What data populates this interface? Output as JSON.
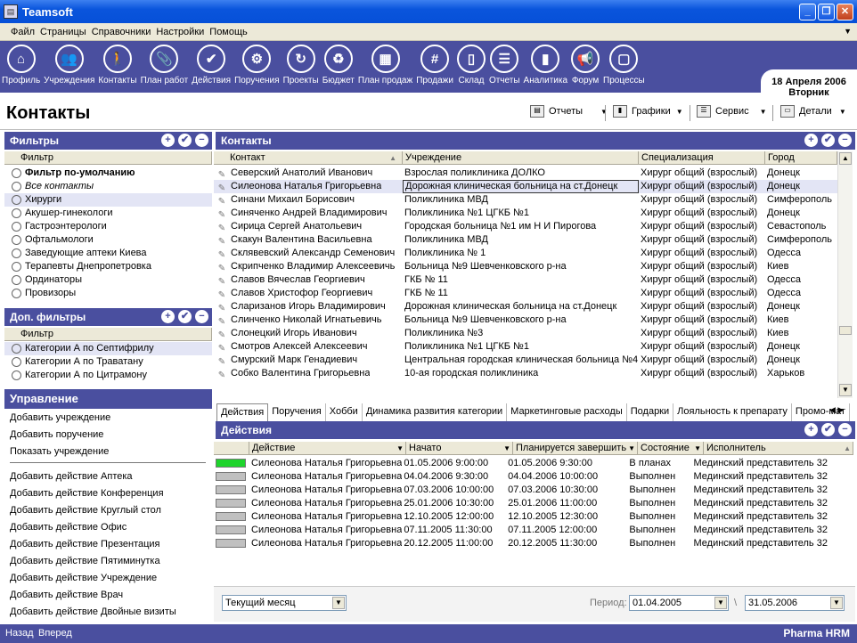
{
  "window": {
    "title": "Teamsoft"
  },
  "menu": [
    "Файл",
    "Страницы",
    "Справочники",
    "Настройки",
    "Помощь"
  ],
  "toolbar": [
    {
      "label": "Профиль",
      "icon": "home-icon",
      "glyph": "⌂"
    },
    {
      "label": "Учреждения",
      "icon": "people-icon",
      "glyph": "👥"
    },
    {
      "label": "Контакты",
      "icon": "person-icon",
      "glyph": "🚶"
    },
    {
      "label": "План работ",
      "icon": "paperclip-icon",
      "glyph": "📎"
    },
    {
      "label": "Действия",
      "icon": "checkmark-icon",
      "glyph": "✔"
    },
    {
      "label": "Поручения",
      "icon": "gears-icon",
      "glyph": "⚙"
    },
    {
      "label": "Проекты",
      "icon": "arrow-icon",
      "glyph": "↻"
    },
    {
      "label": "Бюджет",
      "icon": "recycle-icon",
      "glyph": "♻"
    },
    {
      "label": "План продаж",
      "icon": "grid-icon",
      "glyph": "▦"
    },
    {
      "label": "Продажи",
      "icon": "hash-icon",
      "glyph": "#"
    },
    {
      "label": "Склад",
      "icon": "phone-icon",
      "glyph": "▯"
    },
    {
      "label": "Отчеты",
      "icon": "document-icon",
      "glyph": "☰"
    },
    {
      "label": "Аналитика",
      "icon": "bar-chart-icon",
      "glyph": "▮"
    },
    {
      "label": "Форум",
      "icon": "megaphone-icon",
      "glyph": "📢"
    },
    {
      "label": "Процессы",
      "icon": "box-icon",
      "glyph": "▢"
    }
  ],
  "date": {
    "line1": "18 Апреля 2006",
    "line2": "Вторник"
  },
  "page": {
    "title": "Контакты"
  },
  "header_buttons": {
    "reports": "Отчеты",
    "charts": "Графики",
    "service": "Сервис",
    "details": "Детали"
  },
  "filters": {
    "title": "Фильтры",
    "column": "Фильтр",
    "items": [
      {
        "label": "Фильтр по-умолчанию",
        "style": "bold"
      },
      {
        "label": "Все контакты",
        "style": "italic"
      },
      {
        "label": "Хирурги",
        "style": "selected"
      },
      {
        "label": "Акушер-гинекологи",
        "style": ""
      },
      {
        "label": "Гастроэнтерологи",
        "style": ""
      },
      {
        "label": "Офтальмологи",
        "style": ""
      },
      {
        "label": "Заведующие аптеки Киева",
        "style": ""
      },
      {
        "label": "Терапевты Днепропетровка",
        "style": ""
      },
      {
        "label": "Ординаторы",
        "style": ""
      },
      {
        "label": "Провизоры",
        "style": ""
      }
    ]
  },
  "extra_filters": {
    "title": "Доп. фильтры",
    "column": "Фильтр",
    "items": [
      "Категории А по Септифрилу",
      "Категории А по Траватану",
      "Категории А по Цитрамону"
    ]
  },
  "management": {
    "title": "Управление",
    "links1": [
      "Добавить учреждение",
      "Добавить поручение",
      "Показать учреждение"
    ],
    "links2": [
      "Добавить действие Аптека",
      "Добавить действие Конференция",
      "Добавить действие Круглый стол",
      "Добавить действие Офис",
      "Добавить действие Презентация",
      "Добавить действие Пятиминутка",
      "Добавить действие Учреждение",
      "Добавить действие Врач",
      "Добавить действие Двойные визиты"
    ]
  },
  "contacts": {
    "title": "Контакты",
    "columns": [
      "Контакт",
      "Учреждение",
      "Специализация",
      "Город"
    ],
    "rows": [
      [
        "Северский Анатолий Иванович",
        "Взрослая поликлиника ДОЛКО",
        "Хирург общий (взрослый)",
        "Донецк"
      ],
      [
        "Силеонова Наталья Григорьевна",
        "Дорожная клиническая больница на ст.Донецк",
        "Хирург общий (взрослый)",
        "Донецк"
      ],
      [
        "Синани Михаил Борисович",
        "Поликлиника МВД",
        "Хирург общий (взрослый)",
        "Симферополь"
      ],
      [
        "Синяченко Андрей Владимирович",
        "Поликлиника №1 ЦГКБ №1",
        "Хирург общий (взрослый)",
        "Донецк"
      ],
      [
        "Сирица Сергей Анатольевич",
        "Городская больница №1 им Н И Пирогова",
        "Хирург общий (взрослый)",
        "Севастополь"
      ],
      [
        "Скакун Валентина Васильевна",
        "Поликлиника МВД",
        "Хирург общий (взрослый)",
        "Симферополь"
      ],
      [
        "Склявевский Александр Семенович",
        "Поликлиника № 1",
        "Хирург общий (взрослый)",
        "Одесса"
      ],
      [
        "Скрипченко Владимир Алексеевичь",
        "Больница №9 Шевченковского р-на",
        "Хирург общий (взрослый)",
        "Киев"
      ],
      [
        "Славов Вячеслав Георгиевич",
        "ГКБ № 11",
        "Хирург общий (взрослый)",
        "Одесса"
      ],
      [
        "Славов Христофор Георгиевич",
        "ГКБ № 11",
        "Хирург общий (взрослый)",
        "Одесса"
      ],
      [
        "Сларизанов Игорь Владимирович",
        "Дорожная клиническая больница на ст.Донецк",
        "Хирург общий (взрослый)",
        "Донецк"
      ],
      [
        "Слинченко Николай Игнатьевичь",
        "Больница №9 Шевченковского р-на",
        "Хирург общий (взрослый)",
        "Киев"
      ],
      [
        "Слонецкий Игорь Иванович",
        "Поликлиника №3",
        "Хирург общий (взрослый)",
        "Киев"
      ],
      [
        "Смотров Алексей Алексеевич",
        "Поликлиника №1 ЦГКБ №1",
        "Хирург общий (взрослый)",
        "Донецк"
      ],
      [
        "Смурский Марк Генадиевич",
        "Центральная городская клиническая больница №4",
        "Хирург общий (взрослый)",
        "Донецк"
      ],
      [
        "Собко Валентина Григорьевна",
        "10-ая городская поликлиника",
        "Хирург общий (взрослый)",
        "Харьков"
      ]
    ]
  },
  "tabs": [
    "Действия",
    "Поручения",
    "Хобби",
    "Динамика развития категории",
    "Маркетинговые расходы",
    "Подарки",
    "Лояльность к препарату",
    "Промо-мат"
  ],
  "actions": {
    "title": "Действия",
    "columns": [
      "Действие",
      "Начато",
      "Планируется завершить",
      "Состояние",
      "Исполнитель"
    ],
    "rows": [
      {
        "status_color": "#1ed42c",
        "cells": [
          "Силеонова Наталья Григорьевна",
          "01.05.2006 9:00:00",
          "01.05.2006 9:30:00",
          "В планах",
          "Мединский представитель 32"
        ]
      },
      {
        "status_color": "#c0c0c0",
        "cells": [
          "Силеонова Наталья Григорьевна",
          "04.04.2006 9:30:00",
          "04.04.2006 10:00:00",
          "Выполнен",
          "Мединский представитель 32"
        ]
      },
      {
        "status_color": "#c0c0c0",
        "cells": [
          "Силеонова Наталья Григорьевна",
          "07.03.2006 10:00:00",
          "07.03.2006 10:30:00",
          "Выполнен",
          "Мединский представитель 32"
        ]
      },
      {
        "status_color": "#c0c0c0",
        "cells": [
          "Силеонова Наталья Григорьевна",
          "25.01.2006 10:30:00",
          "25.01.2006 11:00:00",
          "Выполнен",
          "Мединский представитель 32"
        ]
      },
      {
        "status_color": "#c0c0c0",
        "cells": [
          "Силеонова Наталья Григорьевна",
          "12.10.2005 12:00:00",
          "12.10.2005 12:30:00",
          "Выполнен",
          "Мединский представитель 32"
        ]
      },
      {
        "status_color": "#c0c0c0",
        "cells": [
          "Силеонова Наталья Григорьевна",
          "07.11.2005 11:30:00",
          "07.11.2005 12:00:00",
          "Выполнен",
          "Мединский представитель 32"
        ]
      },
      {
        "status_color": "#c0c0c0",
        "cells": [
          "Силеонова Наталья Григорьевна",
          "20.12.2005 11:00:00",
          "20.12.2005 11:30:00",
          "Выполнен",
          "Мединский представитель 32"
        ]
      }
    ]
  },
  "bottom": {
    "period_select": "Текущий месяц",
    "period_label": "Период:",
    "date_from": "01.04.2005",
    "separator": "\\",
    "date_to": "31.05.2006"
  },
  "status": {
    "back": "Назад",
    "forward": "Вперед",
    "brand": "Pharma HRM"
  },
  "colors": {
    "accent": "#4a4f9f",
    "selected_row": "#e3e5f5"
  }
}
